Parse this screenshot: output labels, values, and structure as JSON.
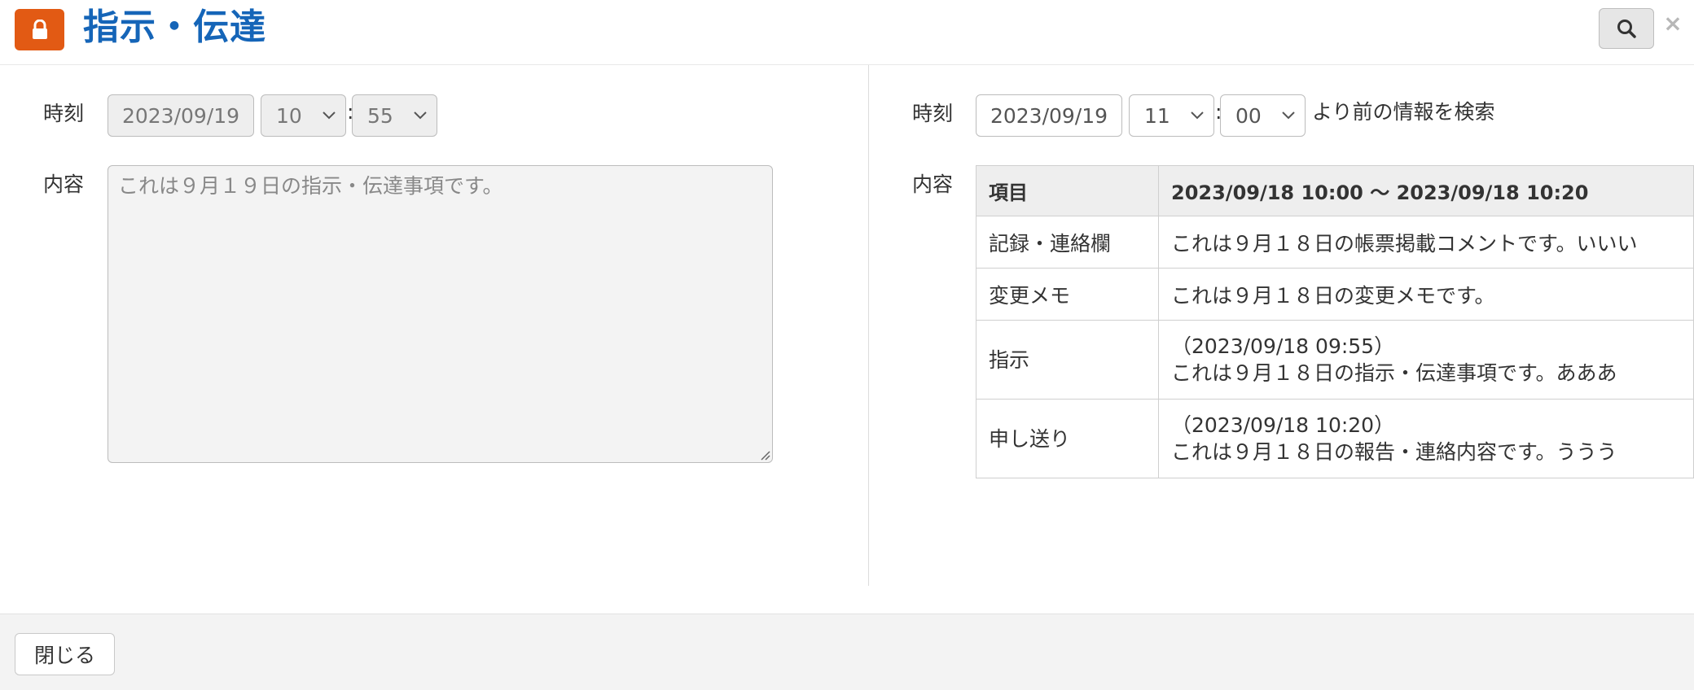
{
  "header": {
    "title": "指示・伝達",
    "lock_icon": "lock-icon",
    "search_icon": "search-icon",
    "close_label": "×",
    "accent_color": "#e25a14",
    "title_color": "#1565b8"
  },
  "left": {
    "time_label": "時刻",
    "date_value": "2023/09/19",
    "hour_value": "10",
    "minute_value": "55",
    "colon": ":",
    "content_label": "内容",
    "content_placeholder": "これは９月１９日の指示・伝達事項です。"
  },
  "right": {
    "time_label": "時刻",
    "date_value": "2023/09/19",
    "hour_value": "11",
    "minute_value": "00",
    "colon": ":",
    "search_suffix": "より前の情報を検索",
    "content_label": "内容",
    "table": {
      "header_key": "項目",
      "header_value": "2023/09/18 10:00 ～ 2023/09/18 10:20",
      "rows": [
        {
          "key": "記録・連絡欄",
          "lines": [
            "これは９月１８日の帳票掲載コメントです。いいい"
          ]
        },
        {
          "key": "変更メモ",
          "lines": [
            "これは９月１８日の変更メモです。"
          ]
        },
        {
          "key": "指示",
          "lines": [
            "（2023/09/18 09:55）",
            "これは９月１８日の指示・伝達事項です。あああ"
          ]
        },
        {
          "key": "申し送り",
          "lines": [
            "（2023/09/18 10:20）",
            "これは９月１８日の報告・連絡内容です。ううう"
          ]
        }
      ]
    }
  },
  "footer": {
    "close_button": "閉じる"
  }
}
